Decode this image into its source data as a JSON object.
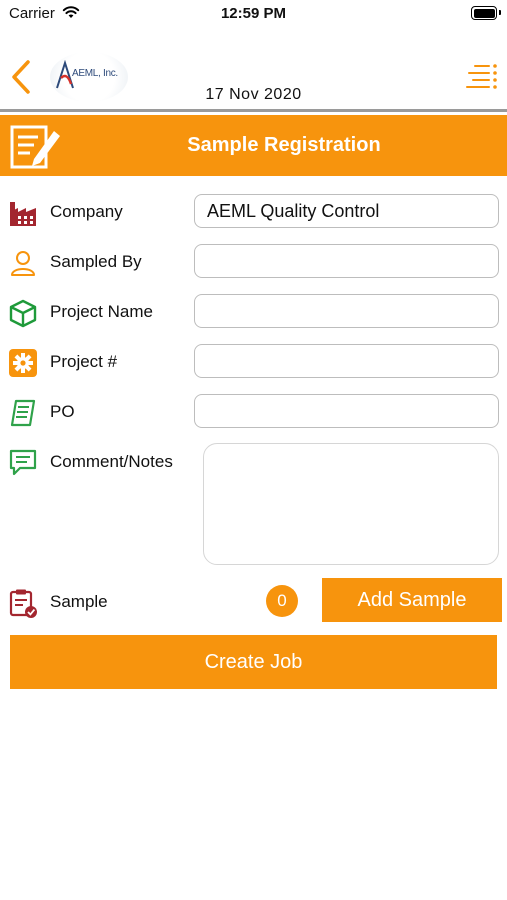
{
  "status_bar": {
    "carrier": "Carrier",
    "time": "12:59 PM"
  },
  "nav": {
    "back_icon": "chevron-left-icon",
    "logo_text": "AEML, Inc.",
    "date": "17 Nov 2020",
    "menu_icon": "list-menu-icon"
  },
  "banner": {
    "icon": "edit-document-icon",
    "title": "Sample Registration"
  },
  "form": {
    "company": {
      "label": "Company",
      "value": "AEML Quality Control",
      "icon": "factory-icon"
    },
    "sampled_by": {
      "label": "Sampled By",
      "value": "",
      "icon": "person-icon"
    },
    "project_name": {
      "label": "Project Name",
      "value": "",
      "icon": "cube-icon"
    },
    "project_number": {
      "label": "Project #",
      "value": "",
      "icon": "gear-icon"
    },
    "po": {
      "label": "PO",
      "value": "",
      "icon": "receipt-icon"
    },
    "notes": {
      "label": "Comment/Notes",
      "value": "",
      "icon": "comment-icon"
    }
  },
  "sample": {
    "label": "Sample",
    "count": "0",
    "add_label": "Add Sample",
    "icon": "clipboard-check-icon"
  },
  "create_job_label": "Create Job",
  "colors": {
    "accent": "#f7940d",
    "company_icon": "#a3262f",
    "person_icon": "#f7940d",
    "cube_icon": "#1f9a3a",
    "po_icon": "#2fa24a",
    "notes_icon": "#2fa24a",
    "sample_icon": "#a3262f"
  }
}
